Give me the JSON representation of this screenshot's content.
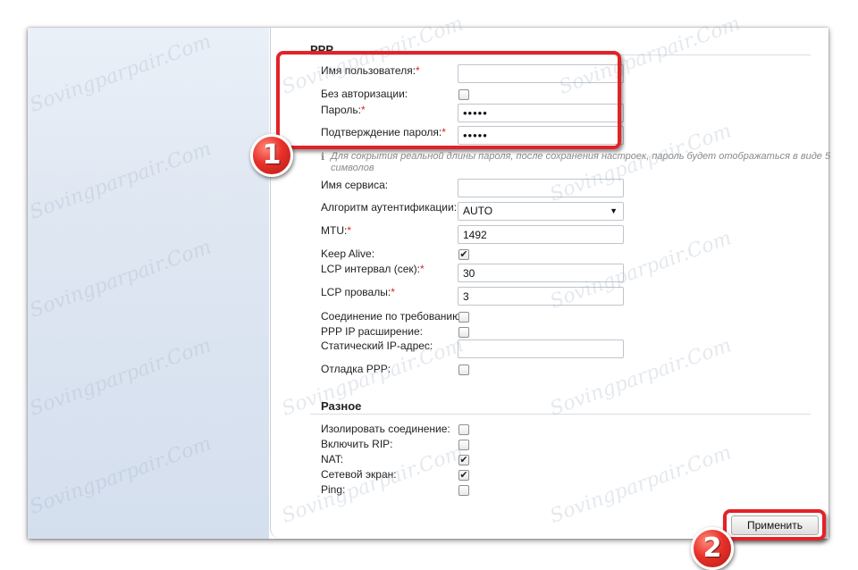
{
  "ppp": {
    "title": "PPP",
    "username_label": "Имя пользователя:",
    "username_value": "",
    "no_auth_label": "Без авторизации:",
    "password_label": "Пароль:",
    "password_value": "•••••",
    "password_confirm_label": "Подтверждение пароля:",
    "password_confirm_value": "•••••",
    "password_hint": "Для сокрытия реальной длины пароля, после сохранения настроек, пароль будет отображаться в виде 5 символов",
    "service_label": "Имя сервиса:",
    "service_value": "",
    "auth_algo_label": "Алгоритм аутентификации:",
    "auth_algo_value": "AUTO",
    "mtu_label": "MTU:",
    "mtu_value": "1492",
    "keep_alive_label": "Keep Alive:",
    "lcp_interval_label": "LCP интервал (сек):",
    "lcp_interval_value": "30",
    "lcp_failures_label": "LCP провалы:",
    "lcp_failures_value": "3",
    "on_demand_label": "Соединение по требованию:",
    "ip_ext_label": "PPP IP расширение:",
    "static_ip_label": "Статический IP-адрес:",
    "static_ip_value": "",
    "debug_label": "Отладка PPP:",
    "required_mark": "*",
    "checked_mark": "✔"
  },
  "misc": {
    "title": "Разное",
    "isolate_label": "Изолировать соединение:",
    "rip_label": "Включить RIP:",
    "nat_label": "NAT:",
    "firewall_label": "Сетевой экран:",
    "ping_label": "Ping:"
  },
  "apply_label": "Применить",
  "badges": {
    "one": "1",
    "two": "2"
  },
  "hint_icon": "ℹ",
  "watermark": "Sovingparpair.Com",
  "colors": {
    "highlight": "#e32228",
    "required": "#d9242a"
  }
}
